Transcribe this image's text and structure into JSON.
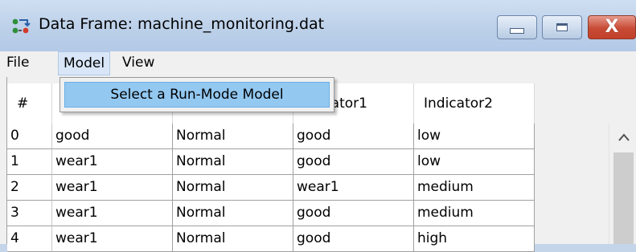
{
  "window": {
    "title": "Data Frame: machine_monitoring.dat",
    "controls": {
      "minimize": "minimize",
      "maximize": "maximize",
      "close": "X"
    }
  },
  "menu": {
    "file": "File",
    "model": "Model",
    "view": "View",
    "dropdown": {
      "items": [
        "Select a Run-Mode Model"
      ]
    }
  },
  "table": {
    "headers": [
      "#",
      "",
      "",
      "Indicator1",
      "Indicator2"
    ],
    "rows": [
      [
        "0",
        "good",
        "Normal",
        "good",
        "low"
      ],
      [
        "1",
        "wear1",
        "Normal",
        "good",
        "low"
      ],
      [
        "2",
        "wear1",
        "Normal",
        "wear1",
        "medium"
      ],
      [
        "3",
        "wear1",
        "Normal",
        "good",
        "medium"
      ],
      [
        "4",
        "wear1",
        "Normal",
        "good",
        "high"
      ]
    ]
  },
  "scrollbar": {
    "up_arrow": "^"
  },
  "colors": {
    "titlebar": "#bcd0e9",
    "close_button": "#c74b35",
    "menu_highlight": "#93c8f1"
  }
}
